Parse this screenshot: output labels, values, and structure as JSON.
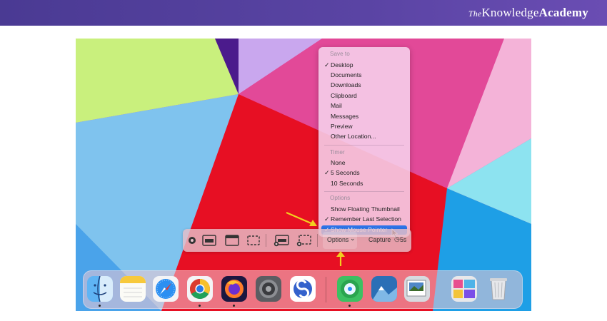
{
  "brand": {
    "the": "The",
    "knowledge": "Knowledge",
    "academy": "Academy"
  },
  "menu": {
    "save_to_header": "Save to",
    "save_to": [
      {
        "label": "Desktop",
        "checked": true
      },
      {
        "label": "Documents",
        "checked": false
      },
      {
        "label": "Downloads",
        "checked": false
      },
      {
        "label": "Clipboard",
        "checked": false
      },
      {
        "label": "Mail",
        "checked": false
      },
      {
        "label": "Messages",
        "checked": false
      },
      {
        "label": "Preview",
        "checked": false
      },
      {
        "label": "Other Location...",
        "checked": false
      }
    ],
    "timer_header": "Timer",
    "timer": [
      {
        "label": "None",
        "checked": false
      },
      {
        "label": "5 Seconds",
        "checked": true
      },
      {
        "label": "10 Seconds",
        "checked": false
      }
    ],
    "options_header": "Options",
    "options": [
      {
        "label": "Show Floating Thumbnail",
        "checked": false
      },
      {
        "label": "Remember Last Selection",
        "checked": true
      },
      {
        "label": "Show Mouse Pointer",
        "checked": true,
        "selected": true
      }
    ],
    "check_glyph": "✓"
  },
  "toolbar": {
    "options_label": "Options",
    "options_chevron": "⌄",
    "capture_label": "Capture",
    "timer_glyph": "◷",
    "timer_value": "5s"
  },
  "dock": {
    "apps": [
      "finder-icon",
      "notes-icon",
      "safari-icon",
      "chrome-icon",
      "firefox-icon",
      "system-preferences-icon",
      "simplenote-icon",
      "find-my-icon",
      "migration-assistant-icon",
      "preview-icon",
      "photo-booth-icon",
      "trash-icon"
    ]
  },
  "colors": {
    "menu_highlight": "#2e74e8",
    "banner": "#4a3a93",
    "arrow": "#f2cf1f"
  }
}
